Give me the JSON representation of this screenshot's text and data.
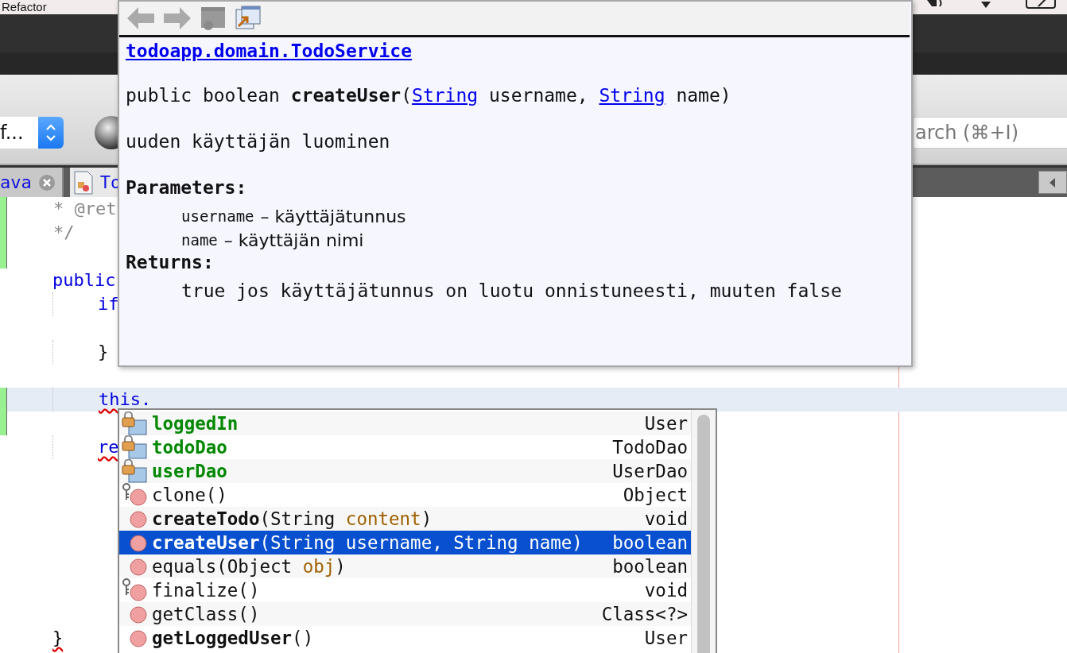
{
  "menu_bar": {
    "items": [
      "Refactor"
    ]
  },
  "toolbar": {
    "combo_value": "f...",
    "search": {
      "placeholder": "arch (⌘+I)"
    }
  },
  "tabs": [
    {
      "label": "ava",
      "selected": false,
      "closable": true
    },
    {
      "label": "To",
      "selected": true,
      "closable": false
    }
  ],
  "editor": {
    "lines": [
      {
        "kind": "comment",
        "text": "* @ret",
        "nested": false,
        "squiggle": false,
        "changed": true,
        "current": false
      },
      {
        "kind": "comment",
        "text": "*/",
        "nested": false,
        "squiggle": false,
        "changed": true,
        "current": false
      },
      {
        "kind": "blank",
        "changed": true,
        "current": false
      },
      {
        "kind": "keyword",
        "text": "public",
        "nested": false,
        "squiggle": false,
        "changed": false,
        "current": false
      },
      {
        "kind": "keyword",
        "text": "if",
        "nested": true,
        "squiggle": false,
        "changed": false,
        "current": false
      },
      {
        "kind": "blank",
        "changed": false,
        "current": false
      },
      {
        "kind": "plain",
        "text": "}",
        "nested": true,
        "squiggle": false,
        "changed": false,
        "current": false
      },
      {
        "kind": "blank",
        "changed": false,
        "current": false
      },
      {
        "kind": "keyword",
        "text": "this.",
        "nested": true,
        "squiggle": true,
        "changed": true,
        "current": true
      },
      {
        "kind": "blank",
        "changed": true,
        "current": false
      },
      {
        "kind": "keyword",
        "text": "re",
        "nested": true,
        "squiggle": true,
        "changed": false,
        "current": false
      },
      {
        "kind": "blank",
        "changed": false,
        "current": false
      },
      {
        "kind": "blank",
        "changed": false,
        "current": false
      },
      {
        "kind": "blank",
        "changed": false,
        "current": false
      },
      {
        "kind": "blank",
        "changed": false,
        "current": false
      },
      {
        "kind": "blank",
        "changed": false,
        "current": false
      },
      {
        "kind": "blank",
        "changed": false,
        "current": false
      },
      {
        "kind": "blank",
        "changed": false,
        "current": false
      },
      {
        "kind": "plain",
        "text": "}",
        "nested": false,
        "squiggle": true,
        "changed": false,
        "current": false
      }
    ]
  },
  "doc_popup": {
    "class_link": "todoapp.domain.TodoService",
    "signature": [
      {
        "kind": "plain",
        "text": "public boolean "
      },
      {
        "kind": "bold",
        "text": "createUser"
      },
      {
        "kind": "plain",
        "text": "("
      },
      {
        "kind": "link",
        "text": "String"
      },
      {
        "kind": "plain",
        "text": " username, "
      },
      {
        "kind": "link",
        "text": "String"
      },
      {
        "kind": "plain",
        "text": " name)"
      }
    ],
    "description": "uuden käyttäjän luominen",
    "parameters_heading": "Parameters:",
    "parameters": [
      {
        "name": "username",
        "desc": "– käyttäjätunnus"
      },
      {
        "name": "name",
        "desc": "– käyttäjän nimi"
      }
    ],
    "returns_heading": "Returns:",
    "returns": "true jos käyttäjätunnus on luotu onnistuneesti, muuten false"
  },
  "completion": {
    "items": [
      {
        "kind": "field",
        "signature": [
          {
            "kind": "name",
            "text": "loggedIn"
          }
        ],
        "type": "User",
        "selected": false
      },
      {
        "kind": "field",
        "signature": [
          {
            "kind": "name",
            "text": "todoDao"
          }
        ],
        "type": "TodoDao",
        "selected": false
      },
      {
        "kind": "field",
        "signature": [
          {
            "kind": "name",
            "text": "userDao"
          }
        ],
        "type": "UserDao",
        "selected": false
      },
      {
        "kind": "inherited",
        "signature": [
          {
            "kind": "plain",
            "text": "clone()"
          }
        ],
        "type": "Object",
        "selected": false
      },
      {
        "kind": "method",
        "signature": [
          {
            "kind": "bold",
            "text": "createTodo"
          },
          {
            "kind": "plain",
            "text": "(String "
          },
          {
            "kind": "param",
            "text": "content"
          },
          {
            "kind": "plain",
            "text": ")"
          }
        ],
        "type": "void",
        "selected": false
      },
      {
        "kind": "method",
        "signature": [
          {
            "kind": "bold",
            "text": "createUser"
          },
          {
            "kind": "plain",
            "text": "(String "
          },
          {
            "kind": "param",
            "text": "username"
          },
          {
            "kind": "plain",
            "text": ", String "
          },
          {
            "kind": "param",
            "text": "name"
          },
          {
            "kind": "plain",
            "text": ")"
          }
        ],
        "type": "boolean",
        "selected": true
      },
      {
        "kind": "method",
        "signature": [
          {
            "kind": "plain",
            "text": "equals(Object "
          },
          {
            "kind": "param",
            "text": "obj"
          },
          {
            "kind": "plain",
            "text": ")"
          }
        ],
        "type": "boolean",
        "selected": false
      },
      {
        "kind": "inherited",
        "signature": [
          {
            "kind": "plain",
            "text": "finalize()"
          }
        ],
        "type": "void",
        "selected": false
      },
      {
        "kind": "method",
        "signature": [
          {
            "kind": "plain",
            "text": "getClass()"
          }
        ],
        "type": "Class<?>",
        "selected": false
      },
      {
        "kind": "method",
        "signature": [
          {
            "kind": "bold",
            "text": "getLoggedUser"
          },
          {
            "kind": "plain",
            "text": "()"
          }
        ],
        "type": "User",
        "selected": false
      }
    ]
  }
}
